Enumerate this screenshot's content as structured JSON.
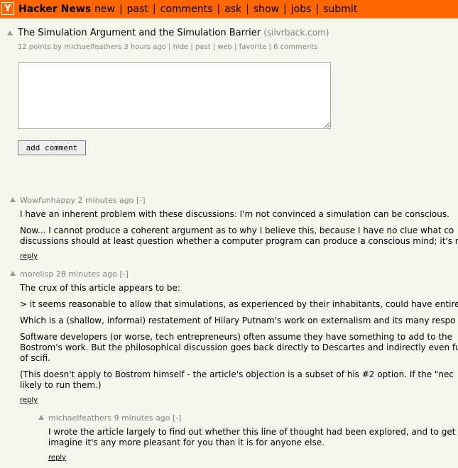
{
  "header": {
    "logo": "Y",
    "brand": "Hacker News",
    "nav": [
      "new",
      "past",
      "comments",
      "ask",
      "show",
      "jobs",
      "submit"
    ],
    "separator": "|"
  },
  "story": {
    "title": "The Simulation Argument and the Simulation Barrier",
    "site": "(silvrback.com)",
    "points": "12 points",
    "by_label": "by",
    "user": "michaelfeathers",
    "age": "3 hours ago",
    "links": [
      "hide",
      "past",
      "web",
      "favorite",
      "6 comments"
    ]
  },
  "comment_form": {
    "textarea_value": "",
    "button_label": "add comment"
  },
  "comments": [
    {
      "user": "Wowfunhappy",
      "age": "2 minutes ago",
      "toggle": "[-]",
      "lines": [
        "I have an inherent problem with these discussions: I'm not convinced a simulation can be conscious.",
        "Now... I cannot produce a coherent argument as to why I believe this, because I have no clue what co",
        "discussions should at least question whether a computer program can produce a conscious mind; it's r"
      ],
      "reply": "reply"
    },
    {
      "user": "morelisp",
      "age": "28 minutes ago",
      "toggle": "[-]",
      "lines": [
        "The crux of this article appears to be:",
        "> it seems reasonable to allow that simulations, as experienced by their inhabitants, could have entire",
        "Which is a (shallow, informal) restatement of Hilary Putnam's work on externalism and its many respo",
        "Software developers (or worse, tech entrepreneurs) often assume they have something to add to the",
        "Bostrom's work. But the philosophical discussion goes back directly to Descartes and indirectly even fu",
        "of scifi.",
        "(This doesn't apply to Bostrom himself - the article's objection is a subset of his #2 option. If the \"nec",
        "likely to run them.)"
      ],
      "reply": "reply"
    },
    {
      "user": "michaelfeathers",
      "age": "9 minutes ago",
      "toggle": "[-]",
      "lines": [
        "I wrote the article largely to find out whether this line of thought had been explored, and to get",
        "imagine it's any more pleasant for you than it is for anyone else."
      ],
      "reply": "reply"
    }
  ]
}
